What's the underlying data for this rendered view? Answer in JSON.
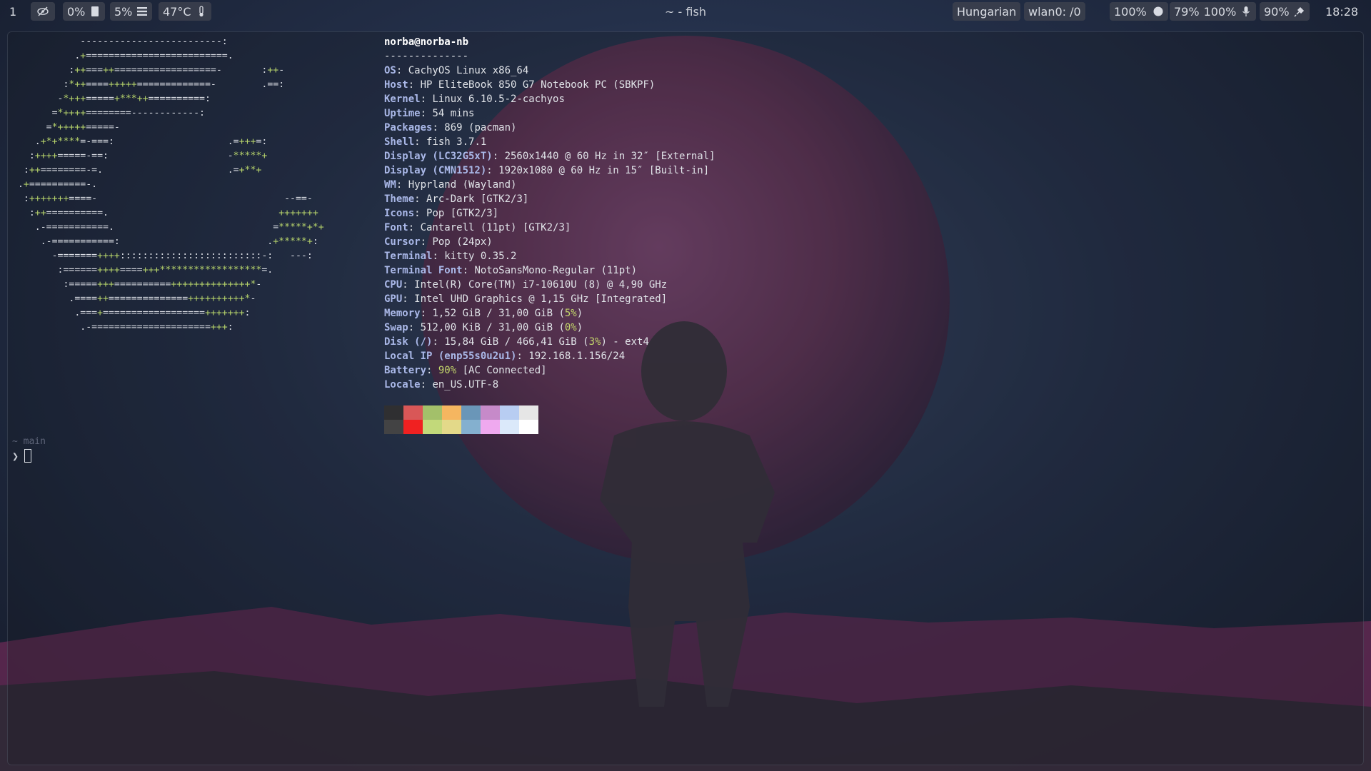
{
  "topbar": {
    "workspace": "1",
    "cpu": "0%",
    "ram": "5%",
    "temperature": "47°C",
    "window_title": "~ - fish",
    "keyboard_layout": "Hungarian",
    "network": "wlan0: /0",
    "brightness": "100%",
    "volume": "79%",
    "mic": "100%",
    "battery": "90%",
    "clock": "18:28"
  },
  "terminal": {
    "logo_lines": [
      "            -------------------------:",
      "           .+=========================.",
      "          :++===++==================-       :++-",
      "         :*++====+++++=============-        .==:",
      "        -*+++=====+***++==========:",
      "       =*++++========------------:",
      "      =*+++++=====-",
      "    .+*+****=-===:                    .=+++=:",
      "   :++++=====-==:                     -*****+",
      "  :++========-=.                      .=+**+",
      " .+==========-.",
      "  :+++++++====-                                 --==-",
      "   :++==========.                              +++++++",
      "    .-===========.                            =*****+*+",
      "     .-===========:                          .+*****+:",
      "       -=======++++:::::::::::::::::::::::::-:   ---:",
      "        :======++++====+++******************=.",
      "         :=====+++==========++++++++++++++*-",
      "          .====++==============++++++++++*-",
      "           .===+==================+++++++:",
      "            .-=====================+++:"
    ],
    "user_host": "norba@norba-nb",
    "separator": "--------------",
    "info": [
      {
        "key": "OS",
        "value": "CachyOS Linux x86_64"
      },
      {
        "key": "Host",
        "value": "HP EliteBook 850 G7 Notebook PC (SBKPF)"
      },
      {
        "key": "Kernel",
        "value": "Linux 6.10.5-2-cachyos"
      },
      {
        "key": "Uptime",
        "value": "54 mins"
      },
      {
        "key": "Packages",
        "value": "869 (pacman)"
      },
      {
        "key": "Shell",
        "value": "fish 3.7.1"
      },
      {
        "key": "Display (LC32G5xT)",
        "value": "2560x1440 @ 60 Hz in 32″ [External]"
      },
      {
        "key": "Display (CMN1512)",
        "value": "1920x1080 @ 60 Hz in 15″ [Built-in]"
      },
      {
        "key": "WM",
        "value": "Hyprland (Wayland)"
      },
      {
        "key": "Theme",
        "value": "Arc-Dark [GTK2/3]"
      },
      {
        "key": "Icons",
        "value": "Pop [GTK2/3]"
      },
      {
        "key": "Font",
        "value": "Cantarell (11pt) [GTK2/3]"
      },
      {
        "key": "Cursor",
        "value": "Pop (24px)"
      },
      {
        "key": "Terminal",
        "value": "kitty 0.35.2"
      },
      {
        "key": "Terminal Font",
        "value": "NotoSansMono-Regular (11pt)"
      },
      {
        "key": "CPU",
        "value": "Intel(R) Core(TM) i7-10610U (8) @ 4,90 GHz"
      },
      {
        "key": "GPU",
        "value": "Intel UHD Graphics @ 1,15 GHz [Integrated]"
      }
    ],
    "memory": {
      "key": "Memory",
      "pre": "1,52 GiB / 31,00 GiB (",
      "pct": "5%",
      "post": ")"
    },
    "swap": {
      "key": "Swap",
      "pre": "512,00 KiB / 31,00 GiB (",
      "pct": "0%",
      "post": ")"
    },
    "disk": {
      "key": "Disk (/)",
      "pre": "15,84 GiB / 466,41 GiB (",
      "pct": "3%",
      "post": ") - ext4"
    },
    "local_ip": {
      "key": "Local IP (enp55s0u2u1)",
      "value": "192.168.1.156/24"
    },
    "battery": {
      "key": "Battery",
      "pct": "90%",
      "post": " [AC Connected]"
    },
    "locale": {
      "key": "Locale",
      "value": "en_US.UTF-8"
    },
    "palette_top": [
      "#2f2f31",
      "#d95757",
      "#a3c06a",
      "#f5b660",
      "#6a96b8",
      "#c68ac9",
      "#b8cdf2",
      "#e6e6e6"
    ],
    "palette_bottom": [
      "#434344",
      "#f02121",
      "#c2d97a",
      "#e3d989",
      "#84b0cf",
      "#efa9ef",
      "#dbe9fa",
      "#ffffff"
    ],
    "prompt_branch": "~ main",
    "prompt_symbol": "❯"
  }
}
